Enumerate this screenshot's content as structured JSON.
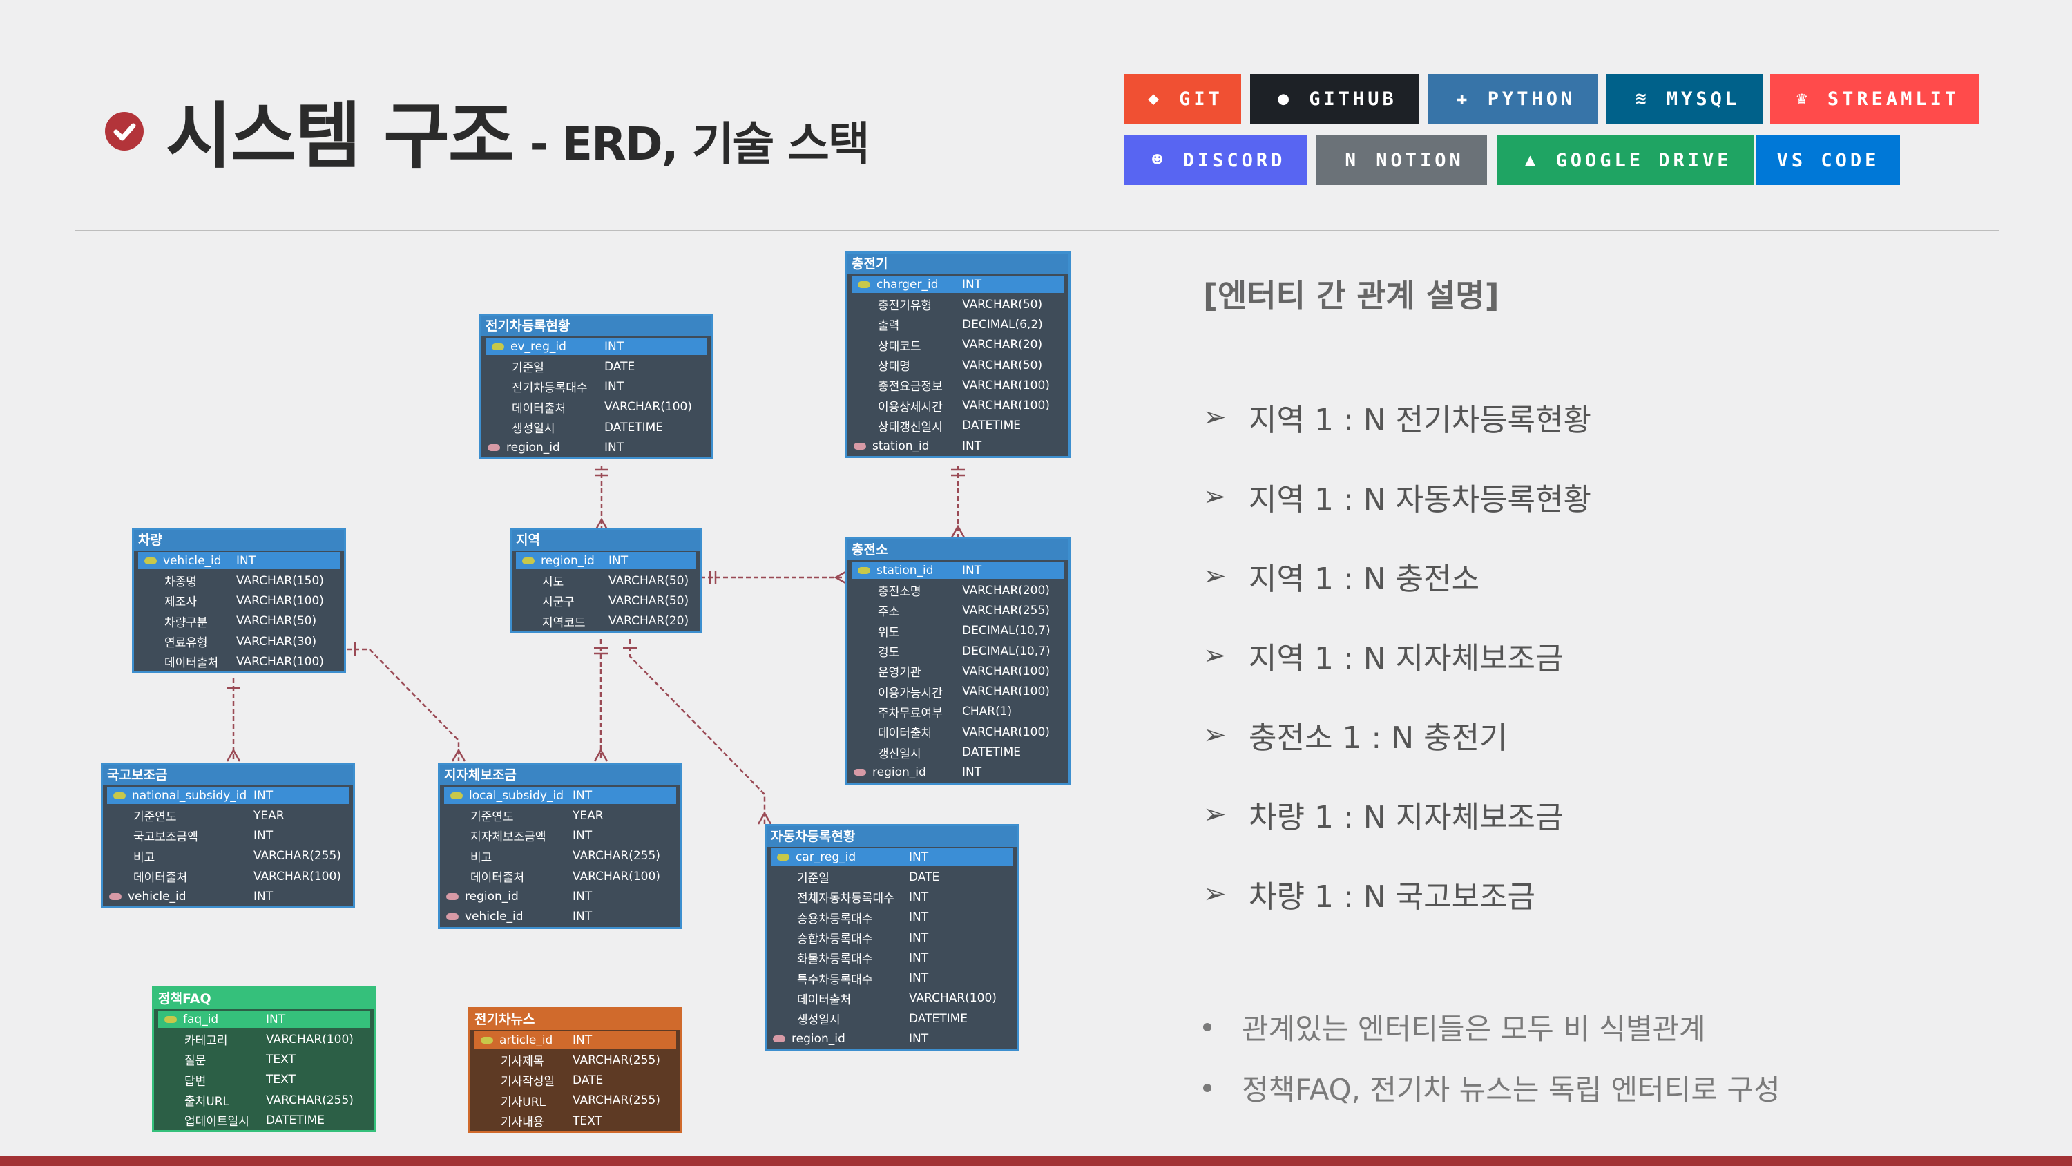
{
  "header": {
    "title_main": "시스템 구조",
    "title_sub": "- ERD, 기술 스택"
  },
  "badges": [
    {
      "label": "GIT",
      "color": "#f05033",
      "icon": "git-icon",
      "glyph": "◆"
    },
    {
      "label": "GITHUB",
      "color": "#1d2126",
      "icon": "github-icon",
      "glyph": "●"
    },
    {
      "label": "PYTHON",
      "color": "#3774a8",
      "icon": "python-icon",
      "glyph": "✚"
    },
    {
      "label": "MYSQL",
      "color": "#00618a",
      "icon": "mysql-icon",
      "glyph": "≋"
    },
    {
      "label": "STREAMLIT",
      "color": "#ff4b4b",
      "icon": "streamlit-icon",
      "glyph": "♛"
    },
    {
      "label": "DISCORD",
      "color": "#5865f2",
      "icon": "discord-icon",
      "glyph": "☻"
    },
    {
      "label": "NOTION",
      "color": "#6b7278",
      "icon": "notion-icon",
      "glyph": "N"
    },
    {
      "label": "GOOGLE DRIVE",
      "color": "#1fa463",
      "icon": "google-drive-icon",
      "glyph": "▲"
    },
    {
      "label": "VS CODE",
      "color": "#0078d7",
      "icon": "vscode-icon",
      "glyph": ""
    }
  ],
  "entities": {
    "charger": {
      "title": "충전기",
      "rows": [
        [
          "charger_id",
          "INT",
          "pk"
        ],
        [
          "충전기유형",
          "VARCHAR(50)",
          ""
        ],
        [
          "출력",
          "DECIMAL(6,2)",
          ""
        ],
        [
          "상태코드",
          "VARCHAR(20)",
          ""
        ],
        [
          "상태명",
          "VARCHAR(50)",
          ""
        ],
        [
          "충전요금정보",
          "VARCHAR(100)",
          ""
        ],
        [
          "이용상세시간",
          "VARCHAR(100)",
          ""
        ],
        [
          "상태갱신일시",
          "DATETIME",
          ""
        ],
        [
          "station_id",
          "INT",
          "fk"
        ]
      ]
    },
    "ev_reg": {
      "title": "전기차등록현황",
      "rows": [
        [
          "ev_reg_id",
          "INT",
          "pk"
        ],
        [
          "기준일",
          "DATE",
          ""
        ],
        [
          "전기차등록대수",
          "INT",
          ""
        ],
        [
          "데이터출처",
          "VARCHAR(100)",
          ""
        ],
        [
          "생성일시",
          "DATETIME",
          ""
        ],
        [
          "region_id",
          "INT",
          "fk"
        ]
      ]
    },
    "vehicle": {
      "title": "차량",
      "rows": [
        [
          "vehicle_id",
          "INT",
          "pk"
        ],
        [
          "차종명",
          "VARCHAR(150)",
          ""
        ],
        [
          "제조사",
          "VARCHAR(100)",
          ""
        ],
        [
          "차량구분",
          "VARCHAR(50)",
          ""
        ],
        [
          "연료유형",
          "VARCHAR(30)",
          ""
        ],
        [
          "데이터출처",
          "VARCHAR(100)",
          ""
        ]
      ]
    },
    "region": {
      "title": "지역",
      "rows": [
        [
          "region_id",
          "INT",
          "pk"
        ],
        [
          "시도",
          "VARCHAR(50)",
          ""
        ],
        [
          "시군구",
          "VARCHAR(50)",
          ""
        ],
        [
          "지역코드",
          "VARCHAR(20)",
          ""
        ]
      ]
    },
    "station": {
      "title": "충전소",
      "rows": [
        [
          "station_id",
          "INT",
          "pk"
        ],
        [
          "충전소명",
          "VARCHAR(200)",
          ""
        ],
        [
          "주소",
          "VARCHAR(255)",
          ""
        ],
        [
          "위도",
          "DECIMAL(10,7)",
          ""
        ],
        [
          "경도",
          "DECIMAL(10,7)",
          ""
        ],
        [
          "운영기관",
          "VARCHAR(100)",
          ""
        ],
        [
          "이용가능시간",
          "VARCHAR(100)",
          ""
        ],
        [
          "주차무료여부",
          "CHAR(1)",
          ""
        ],
        [
          "데이터출처",
          "VARCHAR(100)",
          ""
        ],
        [
          "갱신일시",
          "DATETIME",
          ""
        ],
        [
          "region_id",
          "INT",
          "fk"
        ]
      ]
    },
    "national": {
      "title": "국고보조금",
      "rows": [
        [
          "national_subsidy_id",
          "INT",
          "pk"
        ],
        [
          "기준연도",
          "YEAR",
          ""
        ],
        [
          "국고보조금액",
          "INT",
          ""
        ],
        [
          "비고",
          "VARCHAR(255)",
          ""
        ],
        [
          "데이터출처",
          "VARCHAR(100)",
          ""
        ],
        [
          "vehicle_id",
          "INT",
          "fk"
        ]
      ]
    },
    "local": {
      "title": "지자체보조금",
      "rows": [
        [
          "local_subsidy_id",
          "INT",
          "pk"
        ],
        [
          "기준연도",
          "YEAR",
          ""
        ],
        [
          "지자체보조금액",
          "INT",
          ""
        ],
        [
          "비고",
          "VARCHAR(255)",
          ""
        ],
        [
          "데이터출처",
          "VARCHAR(100)",
          ""
        ],
        [
          "region_id",
          "INT",
          "fk"
        ],
        [
          "vehicle_id",
          "INT",
          "fk"
        ]
      ]
    },
    "car_reg": {
      "title": "자동차등록현황",
      "rows": [
        [
          "car_reg_id",
          "INT",
          "pk"
        ],
        [
          "기준일",
          "DATE",
          ""
        ],
        [
          "전체자동차등록대수",
          "INT",
          ""
        ],
        [
          "승용차등록대수",
          "INT",
          ""
        ],
        [
          "승합차등록대수",
          "INT",
          ""
        ],
        [
          "화물차등록대수",
          "INT",
          ""
        ],
        [
          "특수차등록대수",
          "INT",
          ""
        ],
        [
          "데이터출처",
          "VARCHAR(100)",
          ""
        ],
        [
          "생성일시",
          "DATETIME",
          ""
        ],
        [
          "region_id",
          "INT",
          "fk"
        ]
      ]
    },
    "faq": {
      "title": "정책FAQ",
      "rows": [
        [
          "faq_id",
          "INT",
          "pk"
        ],
        [
          "카테고리",
          "VARCHAR(100)",
          ""
        ],
        [
          "질문",
          "TEXT",
          ""
        ],
        [
          "답변",
          "TEXT",
          ""
        ],
        [
          "출처URL",
          "VARCHAR(255)",
          ""
        ],
        [
          "업데이트일시",
          "DATETIME",
          ""
        ]
      ]
    },
    "news": {
      "title": "전기차뉴스",
      "rows": [
        [
          "article_id",
          "INT",
          "pk"
        ],
        [
          "기사제목",
          "VARCHAR(255)",
          ""
        ],
        [
          "기사작성일",
          "DATE",
          ""
        ],
        [
          "기사URL",
          "VARCHAR(255)",
          ""
        ],
        [
          "기사내용",
          "TEXT",
          ""
        ]
      ]
    }
  },
  "description": {
    "title": "[엔터티 간 관계 설명]",
    "relations": [
      "지역 1 : N 전기차등록현황",
      "지역 1 : N 자동차등록현황",
      "지역 1 : N 충전소",
      "지역 1 : N 지자체보조금",
      "충전소 1 : N 충전기",
      "차량 1 : N 지자체보조금",
      "차량 1 : N 국고보조금"
    ],
    "notes": [
      "관계있는 엔터티들은 모두 비 식별관계",
      "정책FAQ, 전기차 뉴스는 독립 엔터티로 구성"
    ]
  },
  "colors": {
    "pk_key": "#c8c84a",
    "fk_key": "#d79aa6",
    "line": "#9a4a55"
  }
}
